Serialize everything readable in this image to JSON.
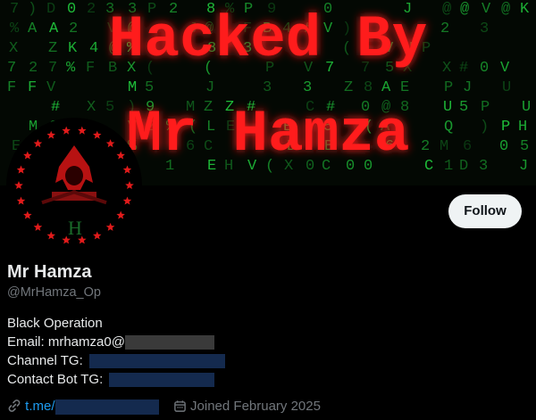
{
  "banner": {
    "line1": "Hacked By",
    "line2": "Mr Hamza",
    "colors": {
      "text": "#ff1a1a",
      "glow": "#ff0000",
      "matrix": "#1fbf3a",
      "bg": "#030803"
    }
  },
  "avatar": {
    "letter": "H",
    "colors": {
      "ring": "#e11b1b",
      "letter": "#1a6b2a",
      "figure": "#b71212"
    }
  },
  "actions": {
    "follow_label": "Follow"
  },
  "profile": {
    "name": "Mr Hamza",
    "handle": "@MrHamza_Op"
  },
  "bio": {
    "line1": "Black Operation",
    "email_label": "Email: mrhamza0@",
    "channel_label": "Channel TG:",
    "contact_label": "Contact Bot TG:"
  },
  "meta": {
    "link_text": "t.me/",
    "joined": "Joined February 2025",
    "icons": [
      "link-icon",
      "calendar-icon"
    ]
  },
  "colors": {
    "accent": "#1d9bf0",
    "secondary_text": "#71767b",
    "redact_gray": "#3a3a3a",
    "redact_navy": "#142a4e"
  }
}
